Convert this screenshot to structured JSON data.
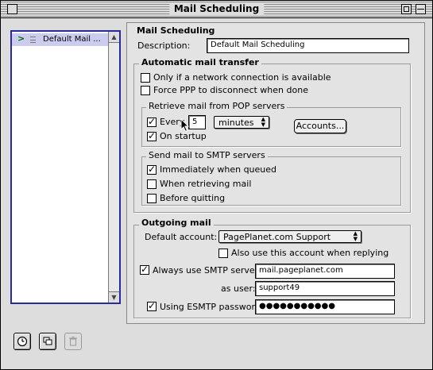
{
  "window": {
    "title": "Mail Scheduling"
  },
  "list": {
    "items": [
      {
        "label": "Default Mail ..."
      }
    ]
  },
  "panel": {
    "heading": "Mail Scheduling",
    "description_label": "Description:",
    "description_value": "Default Mail Scheduling",
    "auto": {
      "legend": "Automatic mail transfer",
      "only_network_label": "Only if a network connection is available",
      "only_network_checked": false,
      "force_ppp_label": "Force PPP to disconnect when done",
      "force_ppp_checked": false,
      "retrieve": {
        "legend": "Retrieve mail from POP servers",
        "every_label": "Every",
        "every_checked": true,
        "every_value": "5",
        "unit_selected": "minutes",
        "accounts_button": "Accounts...",
        "startup_label": "On startup",
        "startup_checked": true
      },
      "send": {
        "legend": "Send mail to SMTP servers",
        "immediately_label": "Immediately when queued",
        "immediately_checked": true,
        "retrieving_label": "When retrieving mail",
        "retrieving_checked": false,
        "quitting_label": "Before quitting",
        "quitting_checked": false
      }
    },
    "outgoing": {
      "legend": "Outgoing mail",
      "default_account_label": "Default account:",
      "default_account_selected": "PagePlanet.com Support",
      "also_use_label": "Also use this account when replying",
      "also_use_checked": false,
      "smtp_label": "Always use SMTP server:",
      "smtp_checked": true,
      "smtp_value": "mail.pageplanet.com",
      "as_user_label": "as user:",
      "as_user_value": "support49",
      "esmtp_label": "Using ESMTP password:",
      "esmtp_checked": true,
      "esmtp_value": "●●●●●●●●●●●"
    }
  },
  "toolbar": {
    "schedule_icon": "clock-icon",
    "duplicate_icon": "duplicate-icon",
    "delete_icon": "trash-icon"
  }
}
